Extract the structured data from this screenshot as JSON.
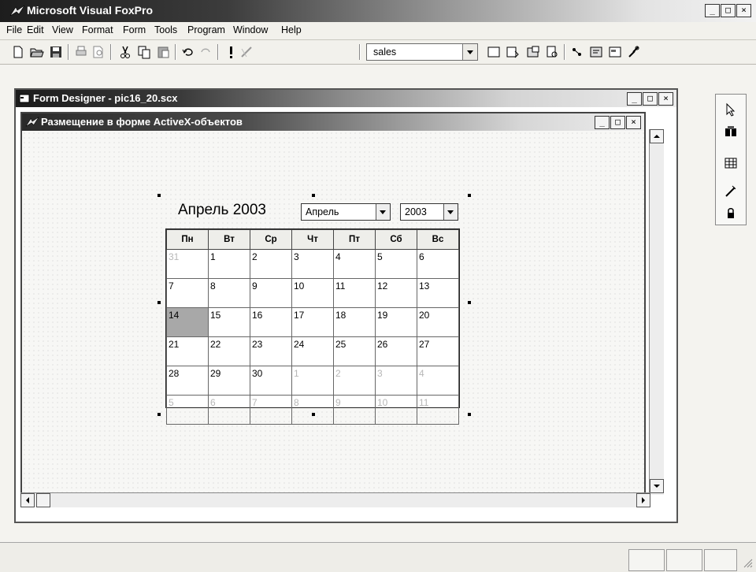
{
  "app": {
    "title": "Microsoft Visual FoxPro",
    "window_buttons": [
      "_",
      "□",
      "×"
    ]
  },
  "menu": {
    "items": [
      "File",
      "Edit",
      "View",
      "Format",
      "Form",
      "Tools",
      "Program",
      "Window",
      "Help"
    ]
  },
  "toolbar": {
    "database_combo_value": "sales",
    "icons": [
      "new-icon",
      "open-icon",
      "save-icon",
      "print-icon",
      "print-preview-icon",
      "cut-icon",
      "copy-icon",
      "paste-icon",
      "undo-icon",
      "redo-icon",
      "run-icon",
      "modify-icon",
      "command-window-icon",
      "view-window-icon",
      "data-session-icon",
      "form-wizard-icon",
      "class-browser-icon",
      "code-icon",
      "form-icon",
      "tools-icon"
    ]
  },
  "form_designer": {
    "title": "Form Designer - pic16_20.scx"
  },
  "inner_form": {
    "title": "Размещение в форме ActiveX-объектов"
  },
  "calendar": {
    "header": "Апрель 2003",
    "month_combo": "Апрель",
    "year_combo": "2003",
    "weekdays": [
      "Пн",
      "Вт",
      "Ср",
      "Чт",
      "Пт",
      "Сб",
      "Вс"
    ],
    "weeks": [
      [
        "31",
        "1",
        "2",
        "3",
        "4",
        "5",
        "6"
      ],
      [
        "7",
        "8",
        "9",
        "10",
        "11",
        "12",
        "13"
      ],
      [
        "14",
        "15",
        "16",
        "17",
        "18",
        "19",
        "20"
      ],
      [
        "21",
        "22",
        "23",
        "24",
        "25",
        "26",
        "27"
      ],
      [
        "28",
        "29",
        "30",
        "1",
        "2",
        "3",
        "4"
      ],
      [
        "5",
        "6",
        "7",
        "8",
        "9",
        "10",
        "11"
      ]
    ],
    "selected_day": "14"
  }
}
